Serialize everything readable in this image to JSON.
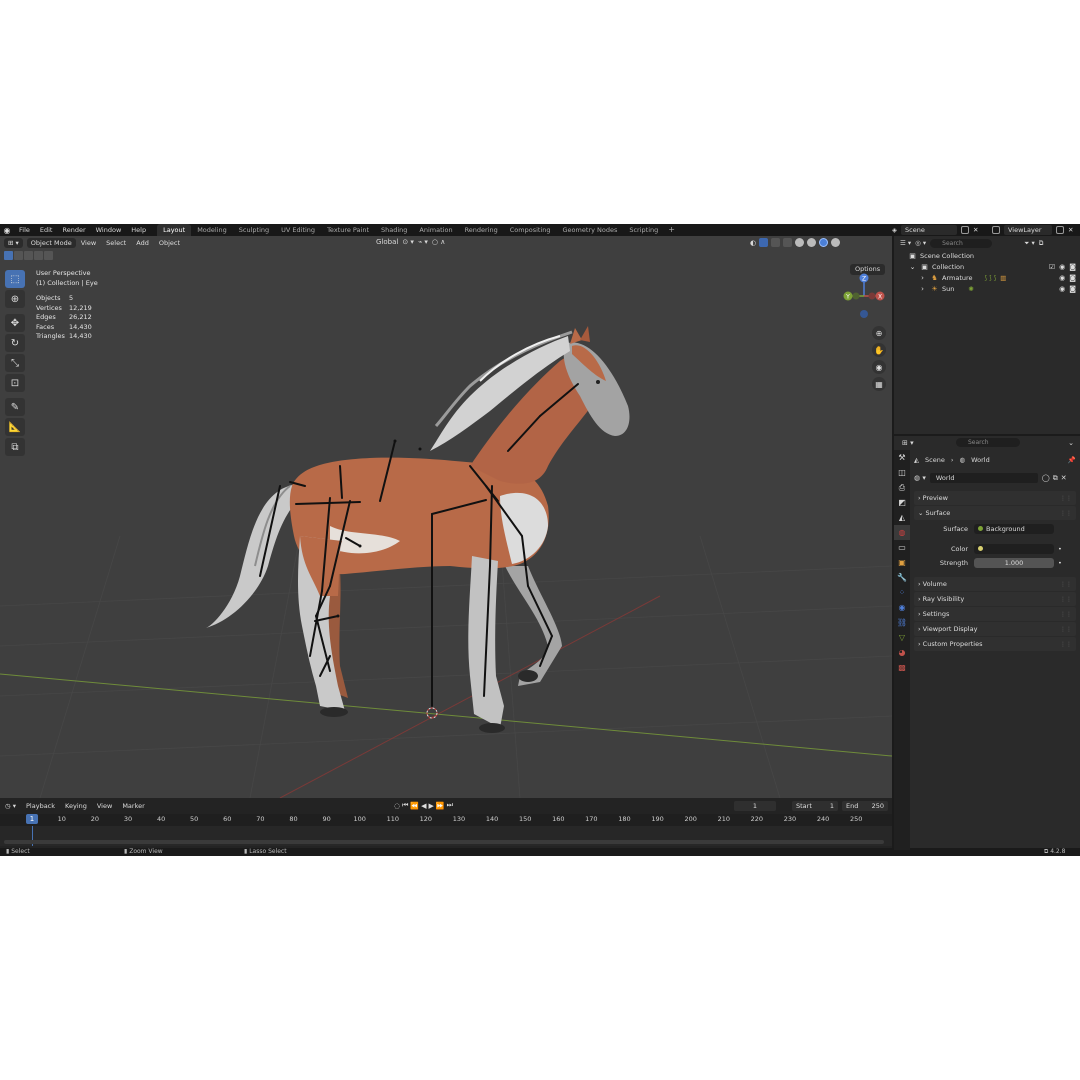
{
  "menu": [
    "File",
    "Edit",
    "Render",
    "Window",
    "Help"
  ],
  "workspaces": [
    "Layout",
    "Modeling",
    "Sculpting",
    "UV Editing",
    "Texture Paint",
    "Shading",
    "Animation",
    "Rendering",
    "Compositing",
    "Geometry Nodes",
    "Scripting"
  ],
  "workspace_add": "+",
  "scene_name": "Scene",
  "view_layer": "ViewLayer",
  "viewport": {
    "mode": "Object Mode",
    "menus": [
      "View",
      "Select",
      "Add",
      "Object"
    ],
    "transform_orientation": "Global",
    "options_label": "Options",
    "perspective": "User Perspective",
    "collection_info": "(1) Collection | Eye",
    "stats": [
      {
        "label": "Objects",
        "value": "5"
      },
      {
        "label": "Vertices",
        "value": "12,219"
      },
      {
        "label": "Edges",
        "value": "26,212"
      },
      {
        "label": "Faces",
        "value": "14,430"
      },
      {
        "label": "Triangles",
        "value": "14,430"
      }
    ],
    "gizmo_axes": {
      "z": "Z",
      "y": "Y",
      "x": "X"
    }
  },
  "timeline": {
    "menus": [
      "Playback",
      "Keying",
      "View",
      "Marker"
    ],
    "current_frame": "1",
    "start_label": "Start",
    "start_value": "1",
    "end_label": "End",
    "end_value": "250",
    "ticks": [
      "10",
      "20",
      "30",
      "40",
      "50",
      "60",
      "70",
      "80",
      "90",
      "100",
      "110",
      "120",
      "130",
      "140",
      "150",
      "160",
      "170",
      "180",
      "190",
      "200",
      "210",
      "220",
      "230",
      "240",
      "250"
    ]
  },
  "statusbar": {
    "select": "Select",
    "zoom": "Zoom View",
    "lasso": "Lasso Select",
    "version": "4.2.8"
  },
  "outliner": {
    "search_placeholder": "Search",
    "scene_collection": "Scene Collection",
    "collection": "Collection",
    "items": [
      {
        "name": "Armature"
      },
      {
        "name": "Sun"
      }
    ]
  },
  "properties": {
    "search_placeholder": "Search",
    "breadcrumb_scene": "Scene",
    "breadcrumb_world": "World",
    "world_name": "World",
    "panels": {
      "preview": "Preview",
      "surface": "Surface",
      "volume": "Volume",
      "ray_visibility": "Ray Visibility",
      "settings": "Settings",
      "viewport_display": "Viewport Display",
      "custom_properties": "Custom Properties"
    },
    "surface_label": "Surface",
    "surface_value": "Background",
    "color_label": "Color",
    "strength_label": "Strength",
    "strength_value": "1.000"
  },
  "colors": {
    "accent": "#4772b3",
    "viewport_bg": "#3f3f3f",
    "horse_coat": "#b86a48",
    "axis_x": "#c0524b",
    "axis_y": "#7ea336",
    "axis_z": "#4f7fd9"
  }
}
